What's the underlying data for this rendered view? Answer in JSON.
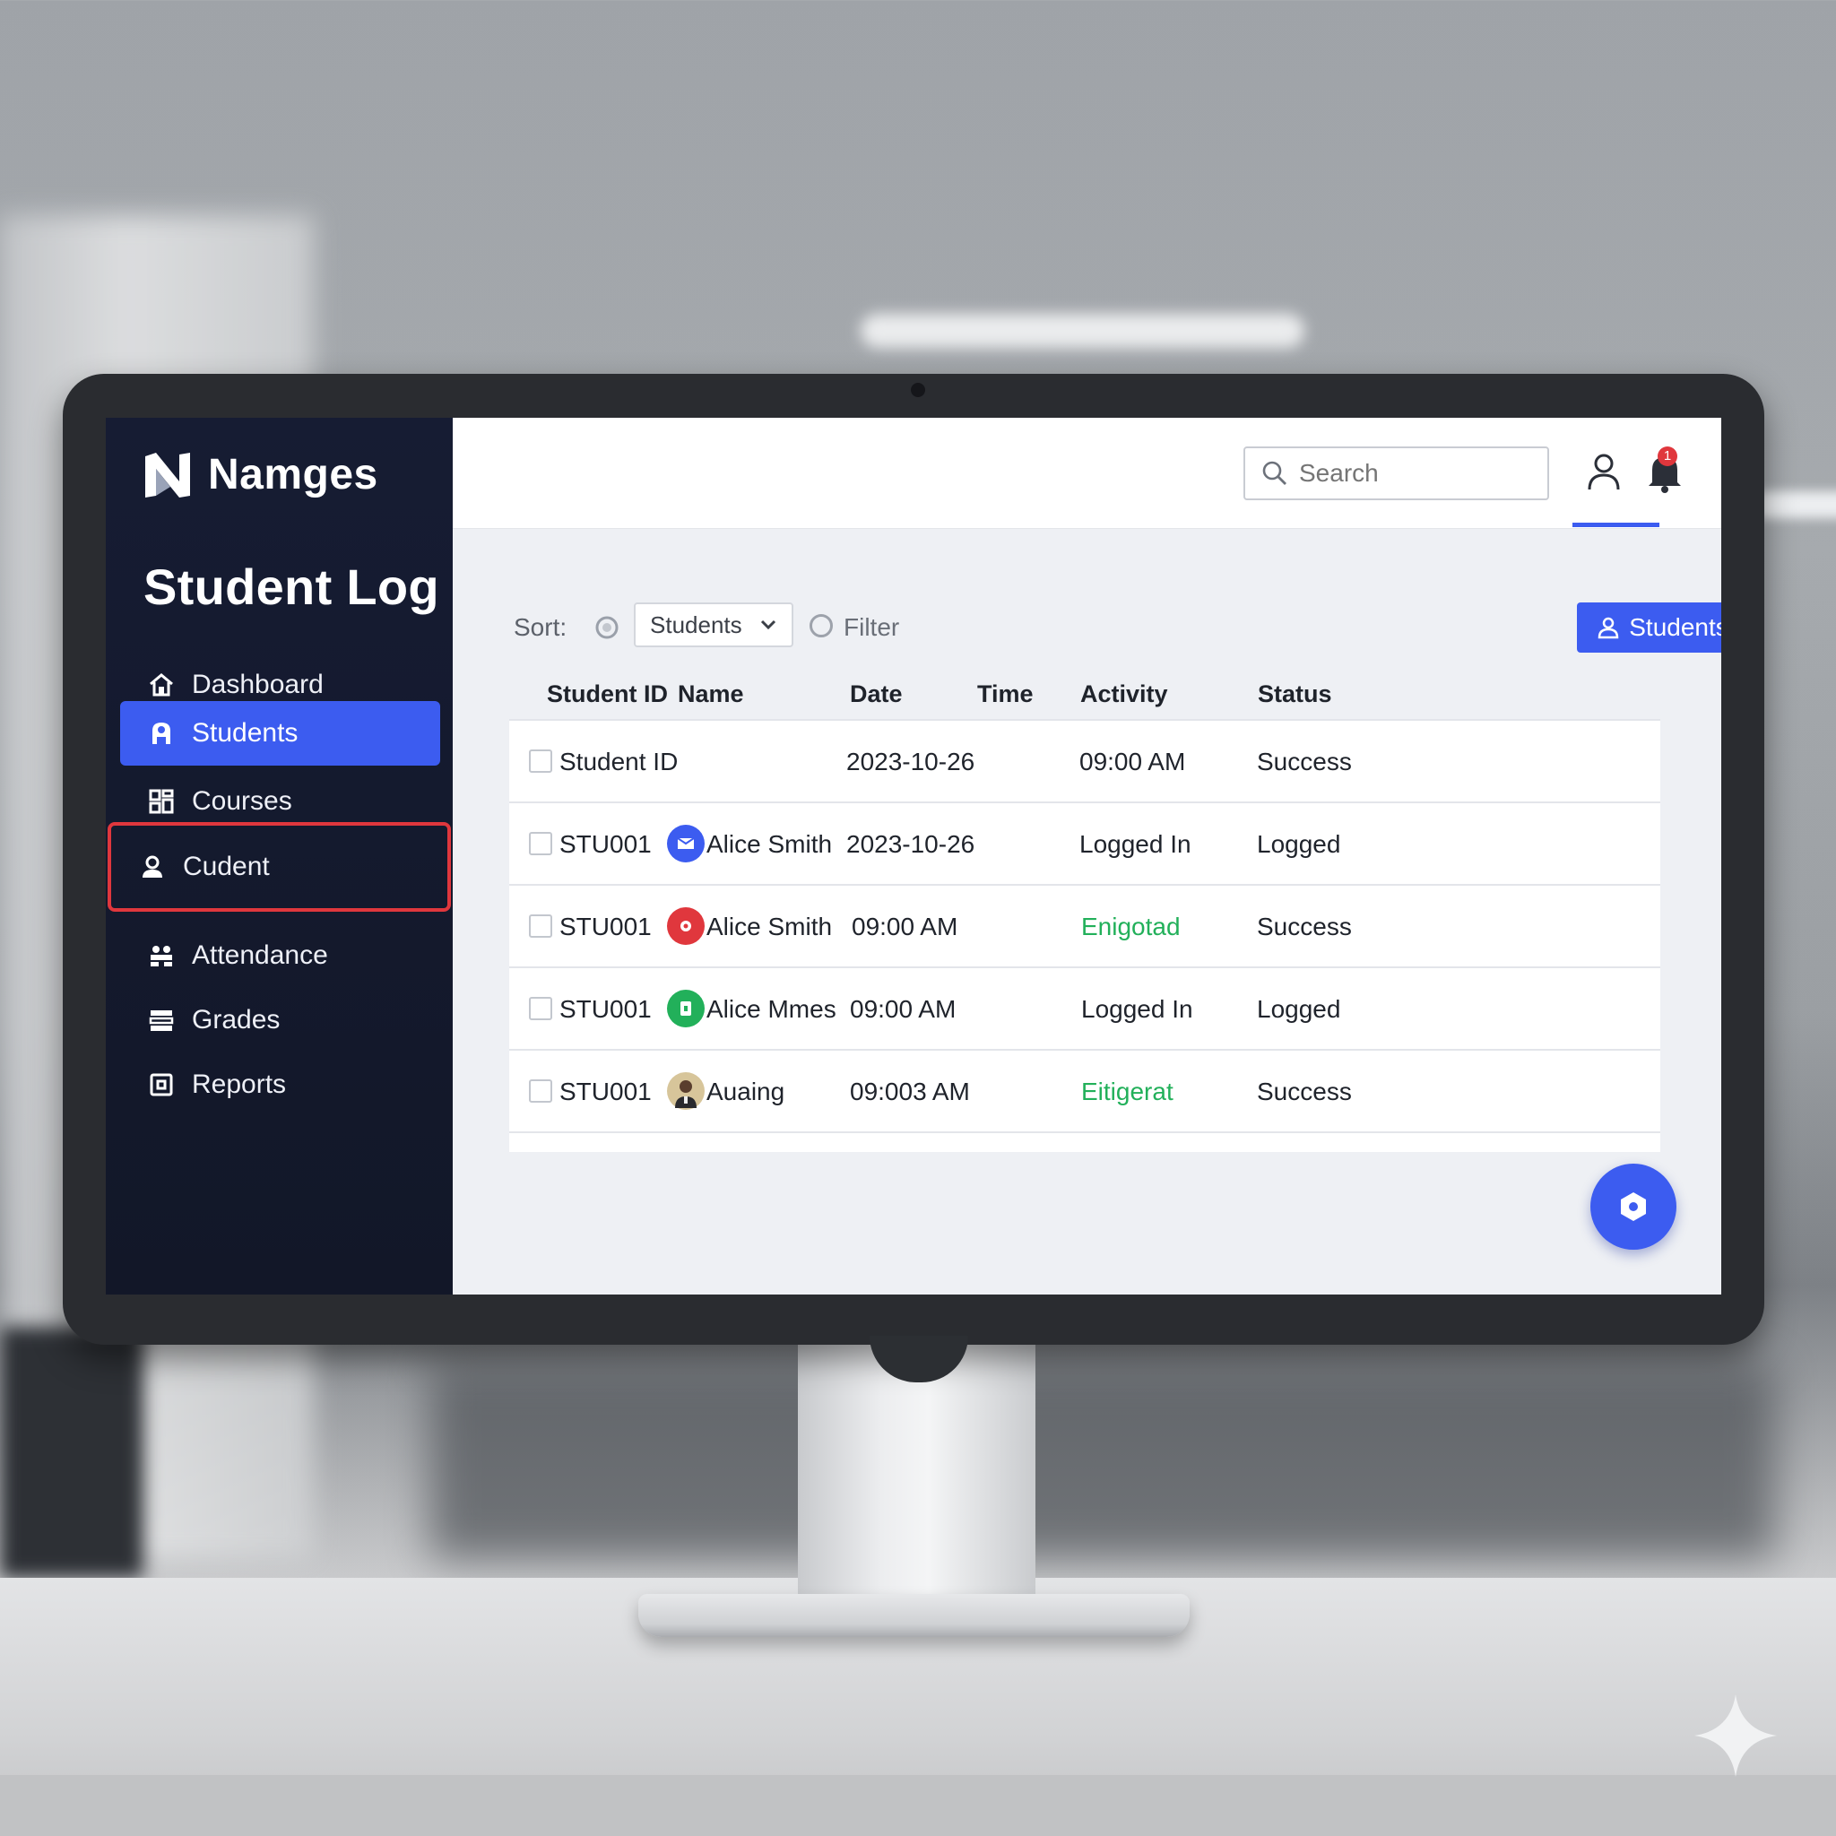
{
  "brand": {
    "name": "Namges"
  },
  "page": {
    "heading": "Student Log"
  },
  "sidebar": {
    "items": [
      {
        "label": "Dashboard",
        "icon": "home-icon",
        "state": "normal"
      },
      {
        "label": "Students",
        "icon": "user-icon",
        "state": "active"
      },
      {
        "label": "Courses",
        "icon": "grid-icon",
        "state": "normal"
      },
      {
        "label": "Cudent",
        "icon": "person-icon",
        "state": "highlighted"
      },
      {
        "label": "Attendance",
        "icon": "group-icon",
        "state": "normal"
      },
      {
        "label": "Grades",
        "icon": "stack-icon",
        "state": "normal"
      },
      {
        "label": "Reports",
        "icon": "report-icon",
        "state": "normal"
      }
    ]
  },
  "header": {
    "search": {
      "placeholder": "Search"
    },
    "notifications": {
      "count": "1"
    }
  },
  "toolbar": {
    "sort_label": "Sort:",
    "sort_value": "Students",
    "filter_label": "Filter",
    "primary_button": "Students"
  },
  "table": {
    "columns": [
      "Student ID",
      "Name",
      "Date",
      "Time",
      "Activity",
      "Status"
    ],
    "rows": [
      {
        "id": "Student ID",
        "name": "",
        "date": "2023-10-26",
        "time": "",
        "activity": "09:00 AM",
        "status": "Success",
        "avatar": "none"
      },
      {
        "id": "STU001",
        "name": "Alice Smith",
        "date": "2023-10-26",
        "time": "",
        "activity": "Logged In",
        "status": "Logged",
        "avatar": "blue"
      },
      {
        "id": "STU001",
        "name": "Alice Smith",
        "date": "09:00 AM",
        "time": "",
        "activity": "Enigotad",
        "status": "Success",
        "avatar": "red"
      },
      {
        "id": "STU001",
        "name": "Alice Mmes",
        "date": "09:00 AM",
        "time": "",
        "activity": "Logged In",
        "status": "Logged",
        "avatar": "green"
      },
      {
        "id": "STU001",
        "name": "Auaing",
        "date": "09:003 AM",
        "time": "",
        "activity": "Eitigerat",
        "status": "Success",
        "avatar": "photo"
      }
    ]
  },
  "colors": {
    "accent": "#3c5cf0",
    "sidebar_bg": "#161c33",
    "highlight_border": "#e0373d",
    "activity_green": "#22b05a"
  }
}
